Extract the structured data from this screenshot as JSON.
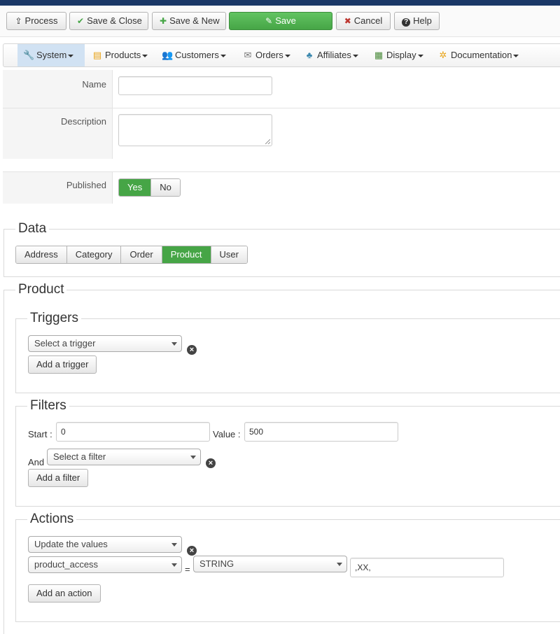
{
  "toolbar": {
    "process": {
      "icon": "⇪",
      "label": "Process"
    },
    "save_close": {
      "icon": "✔",
      "label": "Save & Close"
    },
    "save_new": {
      "icon": "✚",
      "label": "Save & New"
    },
    "save": {
      "icon": "✎",
      "label": "Save"
    },
    "cancel": {
      "icon": "✖",
      "label": "Cancel"
    },
    "help": {
      "icon": "?",
      "label": "Help"
    }
  },
  "nav": {
    "system": {
      "icon": "🔧",
      "label": "System"
    },
    "products": {
      "icon": "▤",
      "label": "Products"
    },
    "customers": {
      "icon": "👥",
      "label": "Customers"
    },
    "orders": {
      "icon": "✉",
      "label": "Orders"
    },
    "affiliates": {
      "icon": "♣",
      "label": "Affiliates"
    },
    "display": {
      "icon": "▦",
      "label": "Display"
    },
    "documentation": {
      "icon": "✲",
      "label": "Documentation"
    }
  },
  "form": {
    "name_label": "Name",
    "name_value": "",
    "description_label": "Description",
    "description_value": "",
    "published_label": "Published",
    "published_yes": "Yes",
    "published_no": "No"
  },
  "data_section": {
    "legend": "Data",
    "tabs": [
      "Address",
      "Category",
      "Order",
      "Product",
      "User"
    ],
    "active_tab": "Product"
  },
  "product_section": {
    "legend": "Product",
    "triggers": {
      "legend": "Triggers",
      "select_value": "Select a trigger",
      "add_button": "Add a trigger"
    },
    "filters": {
      "legend": "Filters",
      "start_label": "Start :",
      "start_value": "0",
      "value_label": "Value :",
      "value_value": "500",
      "and_label": "And",
      "select_value": "Select a filter",
      "add_button": "Add a filter"
    },
    "actions": {
      "legend": "Actions",
      "action_select": "Update the values",
      "field_select": "product_access",
      "equals": "=",
      "type_select": "STRING",
      "value_input": ",XX,",
      "add_button": "Add an action"
    }
  },
  "colors": {
    "header_bar": "#1a3867",
    "success_green": "#46a546",
    "nav_active": "#d1e2f3"
  }
}
